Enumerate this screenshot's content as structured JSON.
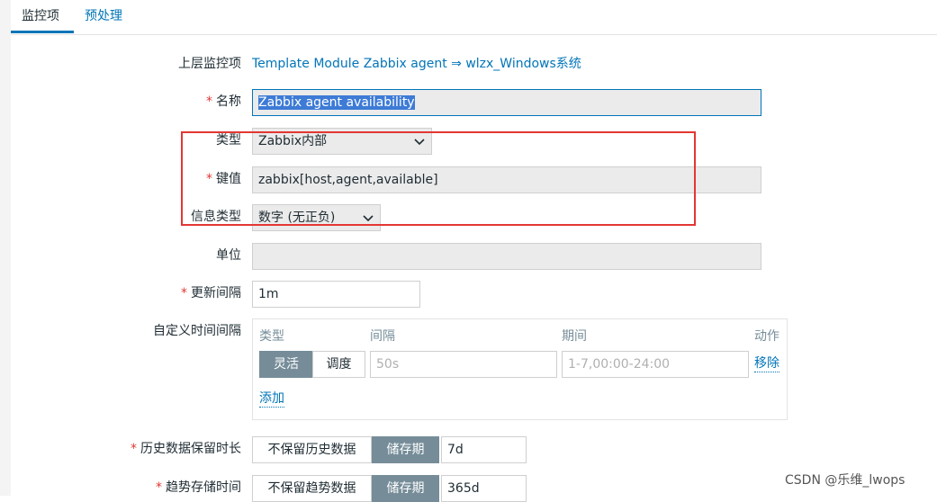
{
  "tabs": [
    {
      "label": "监控项"
    },
    {
      "label": "预处理"
    }
  ],
  "form": {
    "parent_label": "上层监控项",
    "parent_value": "Template Module Zabbix agent ⇒ wlzx_Windows系统",
    "name_label": "名称",
    "name_value": "Zabbix agent availability",
    "type_label": "类型",
    "type_value": "Zabbix内部",
    "key_label": "键值",
    "key_value": "zabbix[host,agent,available]",
    "info_type_label": "信息类型",
    "info_type_value": "数字 (无正负)",
    "units_label": "单位",
    "units_value": "",
    "interval_label": "更新间隔",
    "interval_value": "1m",
    "custom_label": "自定义时间间隔",
    "custom": {
      "col_type": "类型",
      "col_interval": "间隔",
      "col_period": "期间",
      "col_action": "动作",
      "flex_label": "灵活",
      "sched_label": "调度",
      "interval_placeholder": "50s",
      "period_placeholder": "1-7,00:00-24:00",
      "remove_label": "移除",
      "add_label": "添加"
    },
    "history_label": "历史数据保留时长",
    "history_nokeep": "不保留历史数据",
    "history_store": "储存期",
    "history_value": "7d",
    "trends_label": "趋势存储时间",
    "trends_nokeep": "不保留趋势数据",
    "trends_store": "储存期",
    "trends_value": "365d",
    "required_mark": "*"
  },
  "watermark": "CSDN @乐维_lwops",
  "colors": {
    "accent": "#0275b8",
    "required": "#e33734",
    "toggle_on": "#768d99"
  },
  "icons": {
    "dropdown": "chevron-down-icon"
  }
}
